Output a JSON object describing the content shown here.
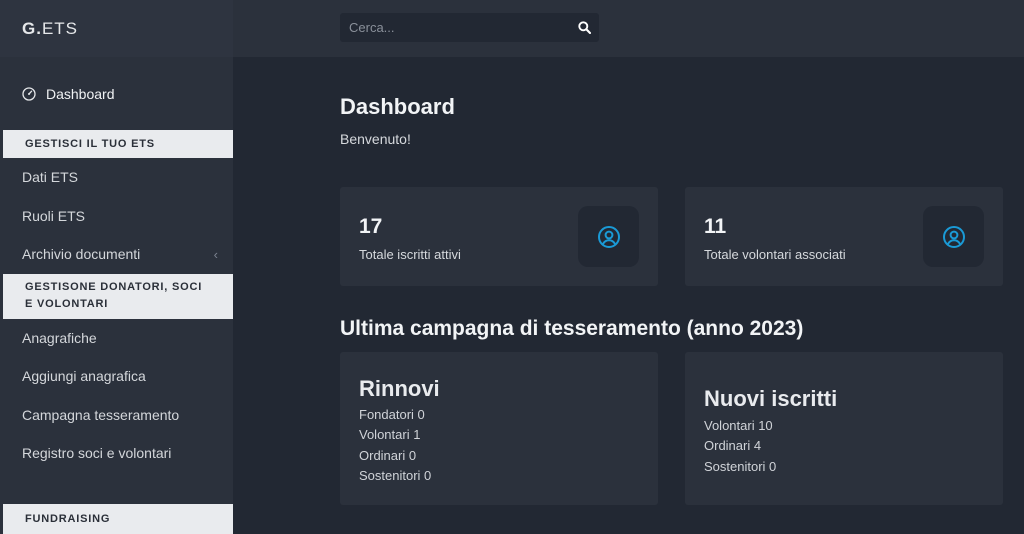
{
  "brand": {
    "bold": "G.",
    "rest": "ETS"
  },
  "sidebar": {
    "dashboard_label": "Dashboard",
    "section1": "GESTISCI IL TUO ETS",
    "items1": [
      "Dati ETS",
      "Ruoli ETS",
      "Archivio documenti"
    ],
    "section2": "GESTISONE DONATORI, SOCI E VOLONTARI",
    "items2": [
      "Anagrafiche",
      "Aggiungi anagrafica",
      "Campagna tesseramento",
      "Registro soci e volontari"
    ],
    "section3": "FUNDRAISING"
  },
  "search": {
    "placeholder": "Cerca..."
  },
  "main": {
    "title": "Dashboard",
    "welcome": "Benvenuto!",
    "stats": [
      {
        "value": "17",
        "label": "Totale iscritti attivi"
      },
      {
        "value": "11",
        "label": "Totale volontari associati"
      }
    ],
    "campaign_title": "Ultima campagna di tesseramento (anno 2023)",
    "rinnovi": {
      "title": "Rinnovi",
      "lines": [
        "Fondatori 0",
        "Volontari 1",
        "Ordinari 0",
        "Sostenitori 0"
      ]
    },
    "nuovi": {
      "title": "Nuovi iscritti",
      "lines": [
        "Volontari 10",
        "Ordinari 4",
        "Sostenitori 0"
      ]
    }
  },
  "colors": {
    "accent": "#1a9ad6",
    "background": "#222833",
    "panel": "#2b313c",
    "section_bg": "#e9ebee"
  },
  "icons": {
    "dashboard": "gauge-icon",
    "search": "search-icon",
    "stat": "user-circle-icon",
    "chevron": "chevron-left-icon"
  }
}
